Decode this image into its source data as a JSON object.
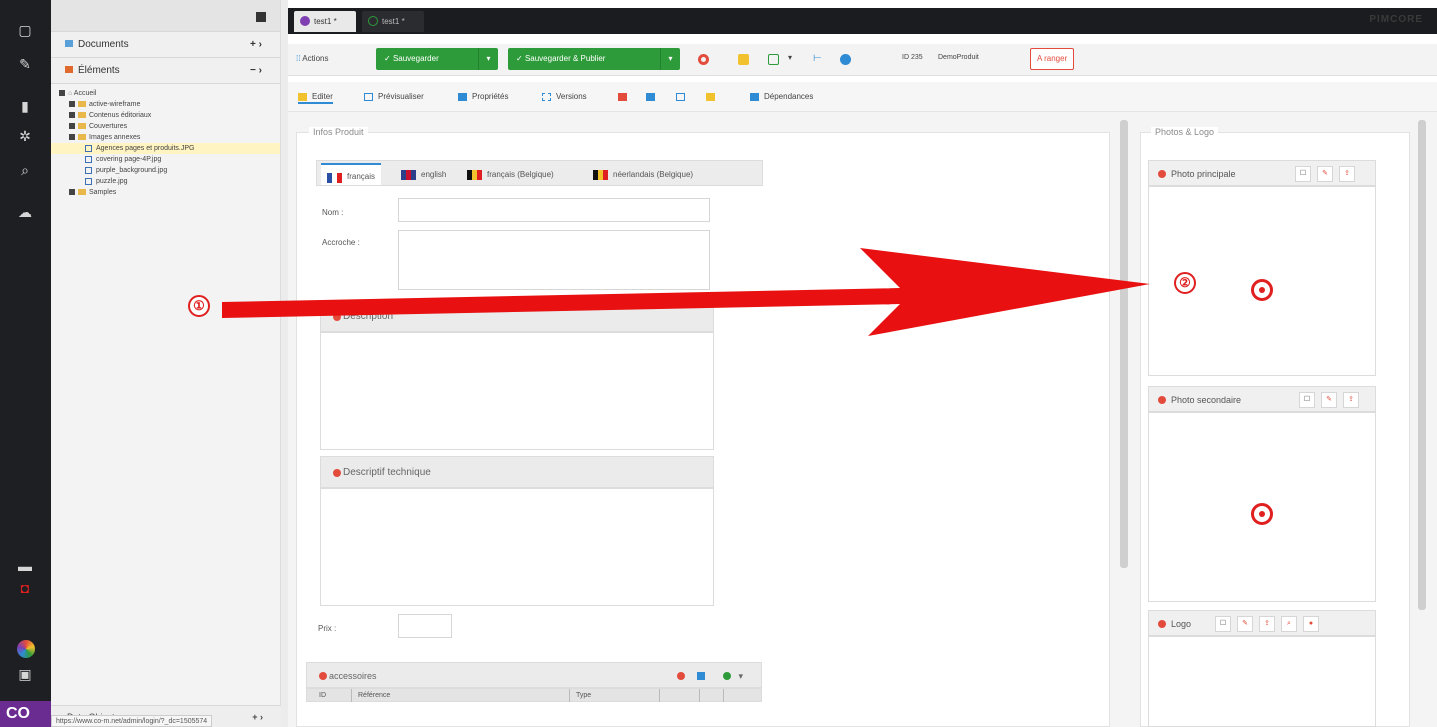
{
  "left_bar": {
    "logo_text": "CO"
  },
  "tree": {
    "documents_label": "Documents",
    "documents_ctrl": "+ ›",
    "elements_label": "Éléments",
    "elements_ctrl": "− ›",
    "nodes": [
      "Accueil",
      "active-wireframe",
      "Contenus éditoriaux",
      "Couvertures",
      "Images annexes",
      "Agences pages et produits.JPG",
      "covering page-4P.jpg",
      "purple_background.jpg",
      "puzzle.jpg",
      "Samples"
    ],
    "bottom_label": "Data Objects",
    "bottom_ctrl": "+ ›",
    "status_url": "https://www.co-m.net/admin/login/?_dc=1505574"
  },
  "tabs": [
    {
      "label": "test1 *"
    },
    {
      "label": "test1 *"
    }
  ],
  "brand": "PIMCORE",
  "toolbar": {
    "actions": "Actions",
    "save": "Sauvegarder",
    "save_publish": "Sauvegarder & Publier",
    "id_text": "ID 235",
    "class_text": "DemoProduit",
    "reload": "A ranger"
  },
  "subtabs": [
    "Editer",
    "Prévisualiser",
    "Propriétés",
    "Versions",
    "",
    "",
    "",
    "",
    "Dépendances"
  ],
  "form": {
    "infos_legend": "Infos Produit",
    "langs": [
      "français",
      "english",
      "français (Belgique)",
      "néerlandais (Belgique)"
    ],
    "nom_label": "Nom :",
    "accroche_label": "Accroche :",
    "description": "Description",
    "descriptif": "Descriptif technique",
    "prix_label": "Prix :",
    "accessoires": "accessoires",
    "col_id": "ID",
    "col_ref": "Référence",
    "col_type": "Type"
  },
  "photos": {
    "legend": "Photos & Logo",
    "principale": "Photo principale",
    "secondaire": "Photo secondaire",
    "logo": "Logo"
  },
  "annotations": [
    "①",
    "②"
  ],
  "colors": {
    "accent_green": "#2e9b3a",
    "annotation_red": "#e02020",
    "purple": "#7f3fb3"
  }
}
